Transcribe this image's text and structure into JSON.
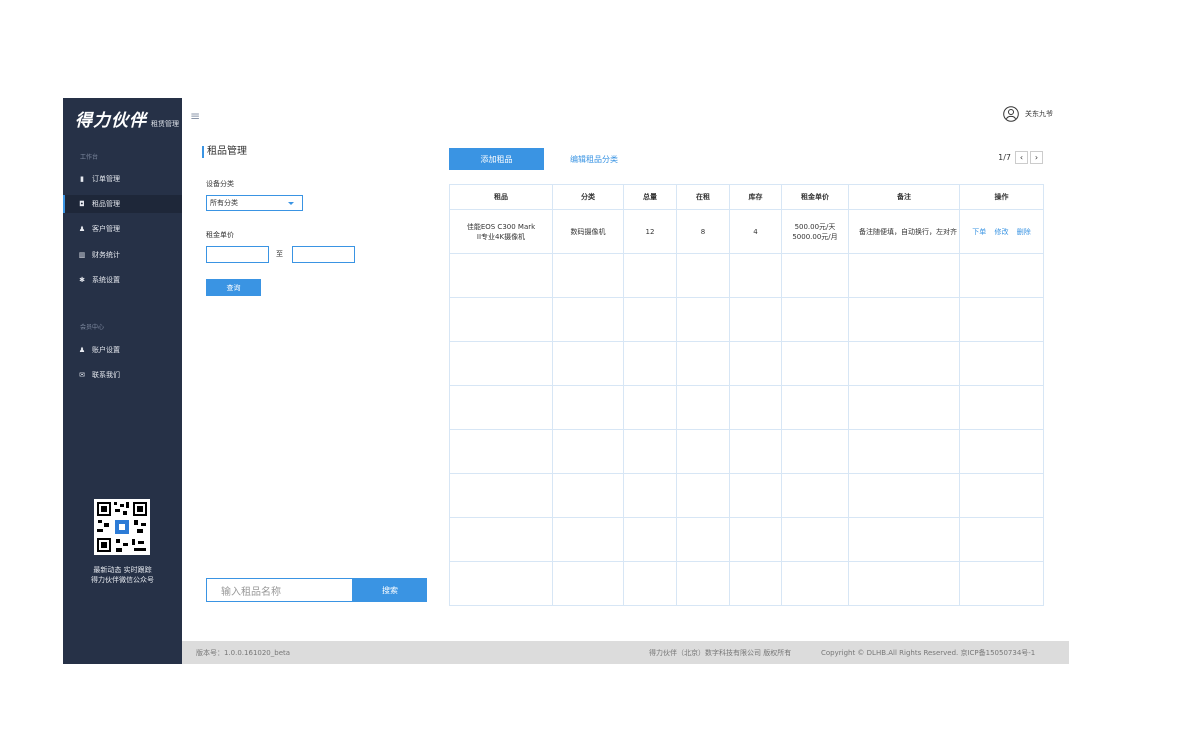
{
  "sidebar": {
    "logo_main": "得力伙伴",
    "logo_sub": "租赁管理",
    "section_workspace": "工作台",
    "items": [
      {
        "icon": "file-icon",
        "glyph": "▮",
        "label": "订单管理"
      },
      {
        "icon": "camera-icon",
        "glyph": "◘",
        "label": "租品管理",
        "active": true
      },
      {
        "icon": "users-icon",
        "glyph": "♟",
        "label": "客户管理"
      },
      {
        "icon": "chart-icon",
        "glyph": "▥",
        "label": "财务统计"
      },
      {
        "icon": "gear-icon",
        "glyph": "✱",
        "label": "系统设置"
      }
    ],
    "section_member": "会员中心",
    "member_items": [
      {
        "icon": "user-icon",
        "glyph": "♟",
        "label": "账户设置"
      },
      {
        "icon": "mail-icon",
        "glyph": "✉",
        "label": "联系我们"
      }
    ],
    "qr_caption_1": "最新动态 实时跟踪",
    "qr_caption_2": "得力伙伴微信公众号"
  },
  "header": {
    "menu_icon": "hamburger-icon",
    "user_name": "关东九爷"
  },
  "filter": {
    "title": "租品管理",
    "category_label": "设备分类",
    "category_value": "所有分类",
    "price_label": "租金单价",
    "price_sep": "至",
    "query_button": "查询",
    "search_placeholder": "输入租品名称",
    "search_button": "搜索"
  },
  "toolbar": {
    "add_button": "添加租品",
    "edit_category_link": "编辑租品分类",
    "page_indicator": "1/7",
    "prev": "‹",
    "next": "›"
  },
  "table": {
    "columns": [
      "租品",
      "分类",
      "总量",
      "在租",
      "库存",
      "租金单价",
      "备注",
      "操作"
    ],
    "rows": [
      {
        "name": "佳能EOS C300 Mark II专业4K摄像机",
        "category": "数码摄像机",
        "total": "12",
        "renting": "8",
        "stock": "4",
        "price": "500.00元/天 5000.00元/月",
        "note": "备注随便填，自动换行，左对齐",
        "ops": [
          "下单",
          "修改",
          "删除"
        ]
      }
    ],
    "empty_rows": 8
  },
  "footer": {
    "version": "版本号：1.0.0.161020_beta",
    "company": "得力伙伴（北京）数字科技有限公司 版权所有",
    "rights": "Copyright © DLHB.All Rights Reserved. 京ICP备15050734号-1"
  }
}
